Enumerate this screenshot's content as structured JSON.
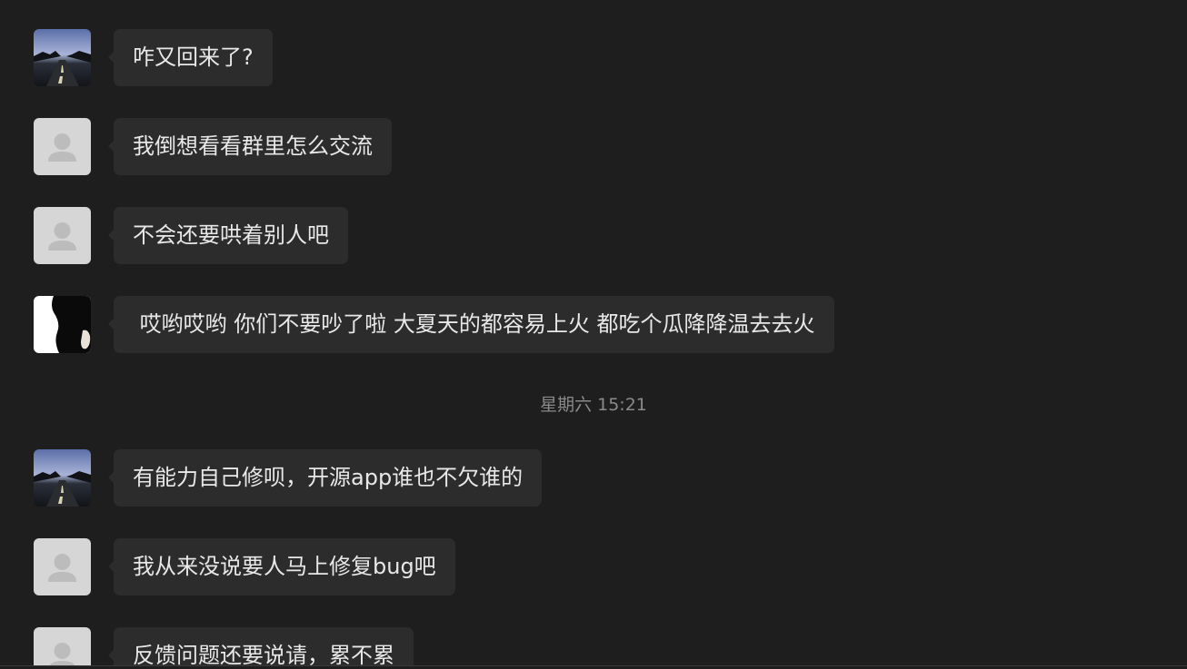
{
  "messages": [
    {
      "text": "咋又回来了?",
      "avatar": "road-photo"
    },
    {
      "text": "我倒想看看群里怎么交流",
      "avatar": "default-user"
    },
    {
      "text": "不会还要哄着别人吧",
      "avatar": "default-user"
    },
    {
      "text": " 哎哟哎哟 你们不要吵了啦 大夏天的都容易上火 都吃个瓜降降温去去火",
      "avatar": "black-white-photo"
    },
    {
      "text": "有能力自己修呗，开源app谁也不欠谁的",
      "avatar": "road-photo"
    },
    {
      "text": "我从来没说要人马上修复bug吧",
      "avatar": "default-user"
    },
    {
      "text": "反馈问题还要说请，累不累",
      "avatar": "default-user"
    }
  ],
  "timestamp": "星期六 15:21",
  "colors": {
    "background": "#1e1e1e",
    "bubble": "#2c2c2c",
    "text": "#e8e8e8",
    "timestamp": "#8a8a8a"
  }
}
